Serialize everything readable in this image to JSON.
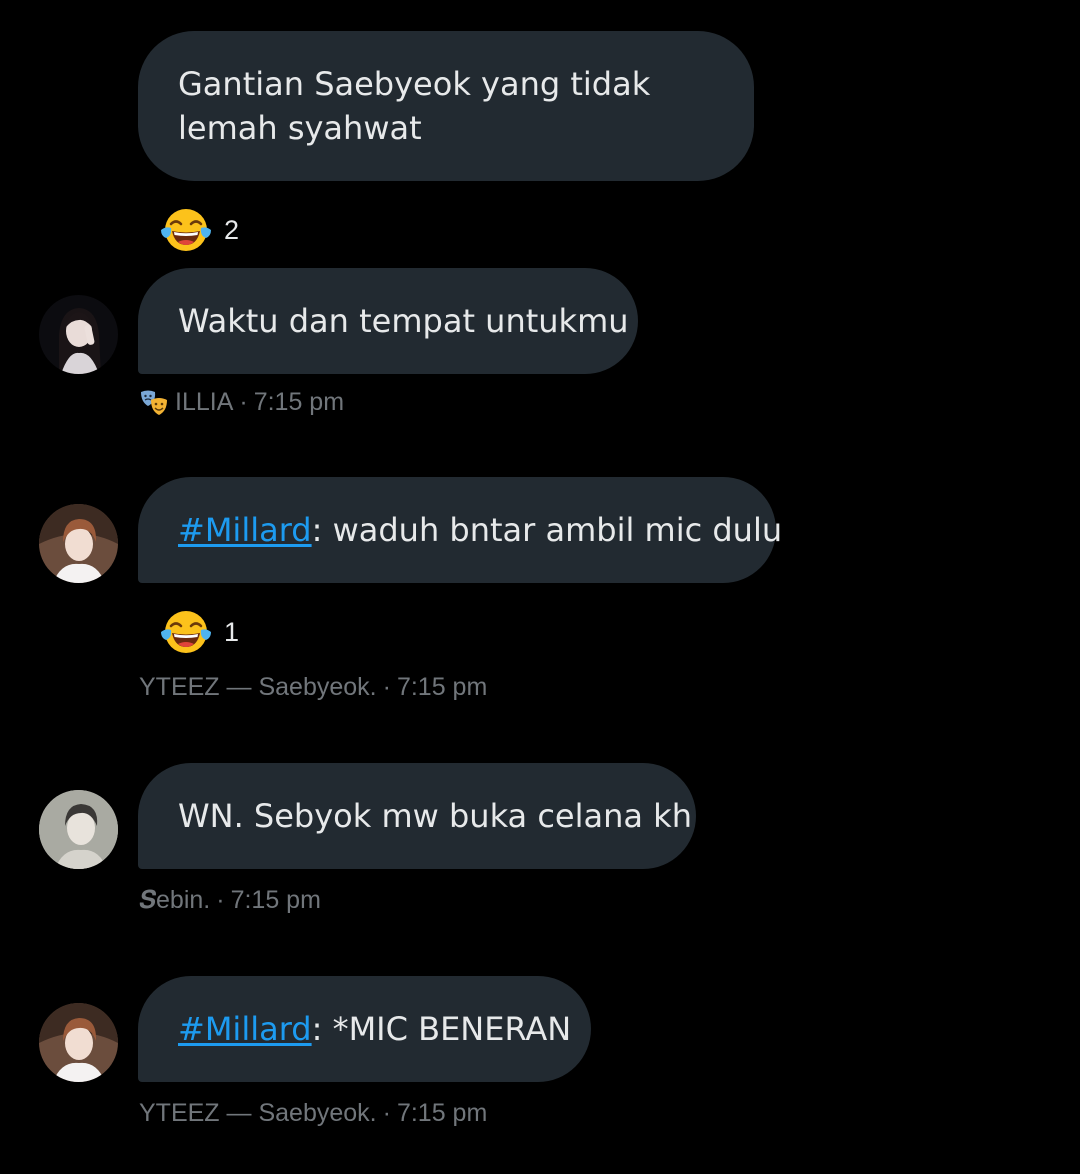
{
  "messages": [
    {
      "text": "Gantian Saebyeok yang tidak lemah syahwat"
    },
    {
      "text": "Waktu dan tempat untukmu"
    },
    {
      "hashtag": "#Millard",
      "text": ": waduh bntar ambil mic dulu"
    },
    {
      "text": "WN. Sebyok mw buka celana kh"
    },
    {
      "hashtag": "#Millard",
      "text": ": *MIC BENERAN"
    }
  ],
  "reactions": [
    {
      "icon": "face-with-tears-of-joy-icon",
      "count": "2"
    },
    {
      "icon": "face-with-tears-of-joy-icon",
      "count": "1"
    }
  ],
  "meta": [
    {
      "icon": "performing-arts-icon",
      "sender": "ILLIA",
      "separator": "·",
      "time": "7:15 pm"
    },
    {
      "sender": "YTEEZ — Saebyeok.",
      "separator": "·",
      "time": "7:15 pm"
    },
    {
      "sender": "𝑺ebin.",
      "separator": "·",
      "time": "7:15 pm"
    },
    {
      "sender": "YTEEZ — Saebyeok.",
      "separator": "·",
      "time": "7:15 pm"
    }
  ],
  "colors": {
    "background": "#000000",
    "bubble": "#222a31",
    "text": "#e7e9ea",
    "meta": "#71767b",
    "hashtag": "#1d9bf0"
  }
}
